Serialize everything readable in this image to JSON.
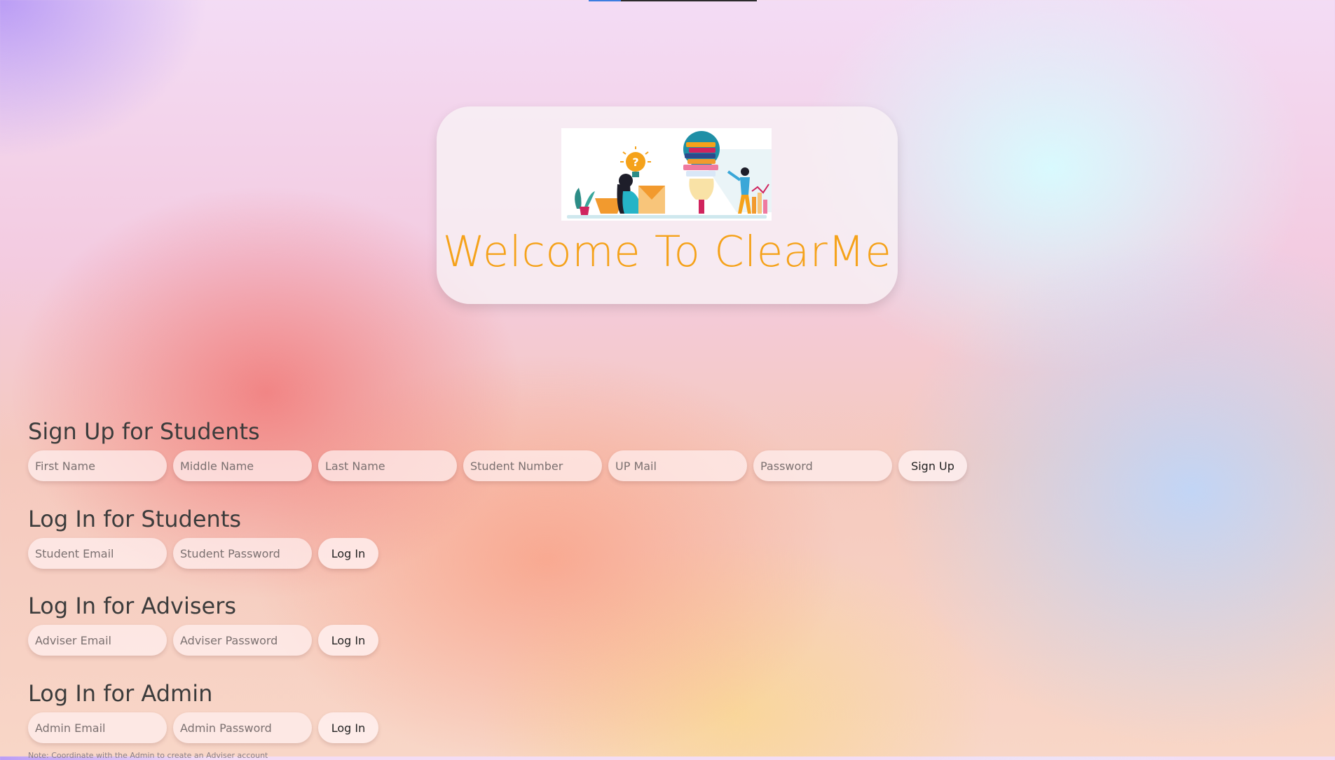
{
  "welcome": {
    "title": "Welcome To ClearMe",
    "illustration": "education-illustration"
  },
  "student_signup": {
    "heading": "Sign Up for Students",
    "first_name_placeholder": "First Name",
    "middle_name_placeholder": "Middle Name",
    "last_name_placeholder": "Last Name",
    "student_number_placeholder": "Student Number",
    "up_mail_placeholder": "UP Mail",
    "password_placeholder": "Password",
    "button_label": "Sign Up"
  },
  "student_login": {
    "heading": "Log In for Students",
    "email_placeholder": "Student Email",
    "password_placeholder": "Student Password",
    "button_label": "Log In"
  },
  "adviser_login": {
    "heading": "Log In for Advisers",
    "email_placeholder": "Adviser Email",
    "password_placeholder": "Adviser Password",
    "button_label": "Log In"
  },
  "admin_login": {
    "heading": "Log In for Admin",
    "email_placeholder": "Admin Email",
    "password_placeholder": "Admin Password",
    "button_label": "Log In"
  },
  "note": "Note: Coordinate with the Admin to create an Adviser account",
  "colors": {
    "title_orange": "#f5a21a",
    "heading_text": "#3c3c3c"
  }
}
